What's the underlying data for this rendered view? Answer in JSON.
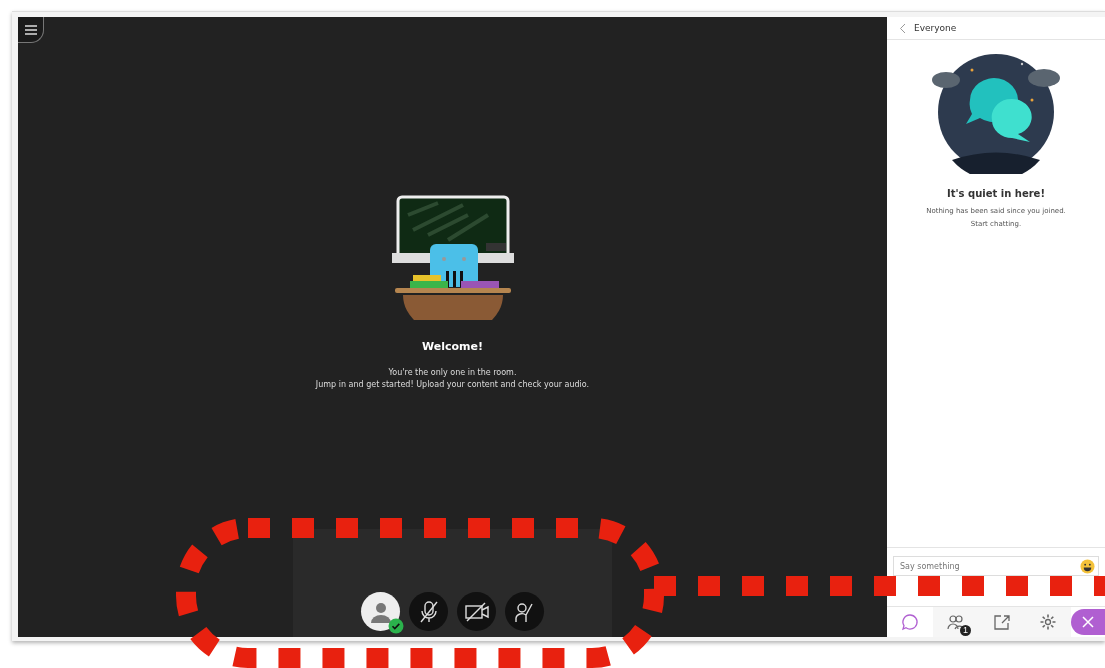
{
  "stage": {
    "title": "Welcome!",
    "lines": [
      "You're the only one in the room.",
      "Jump in and get started! Upload your content and check your audio."
    ]
  },
  "controls": [
    {
      "kind": "avatar",
      "verified": true
    },
    {
      "kind": "microphone",
      "on": false
    },
    {
      "kind": "camera",
      "on": false
    },
    {
      "kind": "hand"
    }
  ],
  "chat": {
    "heading": "Everyone",
    "empty_title": "It's quiet in here!",
    "empty_lines": [
      "Nothing has been said since you joined.",
      "Start chatting."
    ],
    "placeholder": "Say something"
  },
  "tabs": [
    {
      "kind": "chat",
      "selected": true
    },
    {
      "kind": "participants",
      "selected": false,
      "badge": "1"
    },
    {
      "kind": "share",
      "selected": false
    },
    {
      "kind": "settings",
      "selected": false
    }
  ]
}
